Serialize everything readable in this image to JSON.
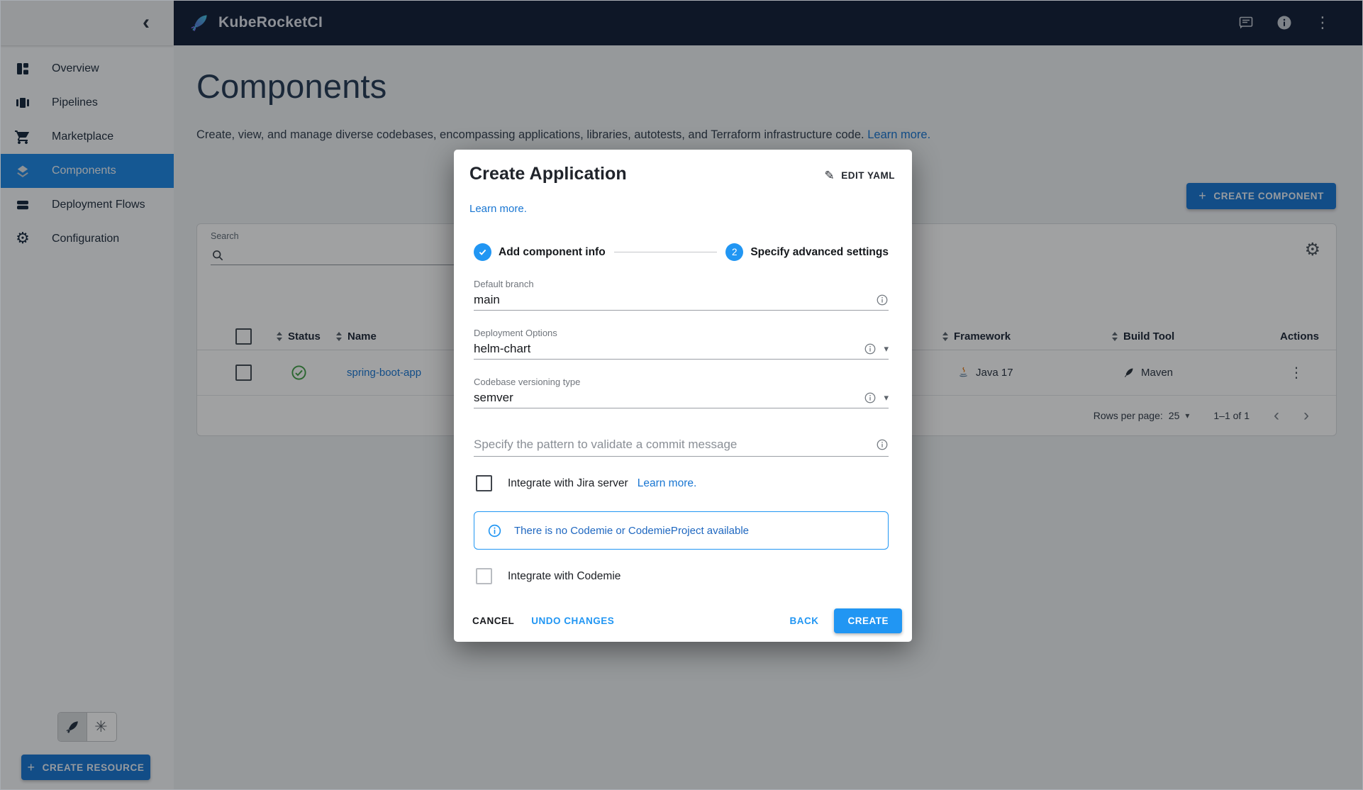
{
  "icons": {
    "collapse": "‹",
    "kebab": "⋮",
    "gear": "⚙",
    "k8s_wheel": "✳",
    "pencil": "✎",
    "plus": "+",
    "caret": "▾",
    "prev": "‹",
    "next": "›"
  },
  "topbar": {
    "app_name": "KubeRocketCI"
  },
  "sidebar": {
    "items": [
      {
        "label": "Overview"
      },
      {
        "label": "Pipelines"
      },
      {
        "label": "Marketplace"
      },
      {
        "label": "Components"
      },
      {
        "label": "Deployment Flows"
      },
      {
        "label": "Configuration"
      }
    ],
    "active_item": "Components",
    "create_resource": "CREATE RESOURCE"
  },
  "page": {
    "title": "Components",
    "description": "Create, view, and manage diverse codebases, encompassing applications, libraries, autotests, and Terraform infrastructure code.",
    "learn_more": "Learn more.",
    "create_component": "CREATE COMPONENT"
  },
  "table": {
    "search_label": "Search",
    "columns": [
      {
        "label": "Status"
      },
      {
        "label": "Name"
      },
      {
        "label": "Framework"
      },
      {
        "label": "Build Tool"
      },
      {
        "label": "Actions"
      }
    ],
    "rows": [
      {
        "status": "success",
        "name": "spring-boot-app",
        "framework": "Java 17",
        "build_tool": "Maven"
      }
    ],
    "pagination": {
      "rows_per_page_label": "Rows per page:",
      "rows_per_page": "25",
      "range": "1–1 of 1"
    }
  },
  "modal": {
    "title": "Create Application",
    "edit_yaml": "EDIT YAML",
    "learn_more": "Learn more.",
    "steps": [
      {
        "label": "Add component info",
        "state": "done"
      },
      {
        "label": "Specify advanced settings",
        "number": "2",
        "state": "active"
      }
    ],
    "fields": {
      "default_branch": {
        "label": "Default branch",
        "value": "main"
      },
      "deployment_options": {
        "label": "Deployment Options",
        "value": "helm-chart"
      },
      "versioning": {
        "label": "Codebase versioning type",
        "value": "semver"
      },
      "commit_pattern": {
        "placeholder": "Specify the pattern to validate a commit message"
      }
    },
    "jira": {
      "label": "Integrate with Jira server",
      "link": "Learn more."
    },
    "alert": {
      "text": "There is no Codemie or CodemieProject available"
    },
    "codemie": {
      "label": "Integrate with Codemie"
    },
    "actions": {
      "cancel": "CANCEL",
      "undo": "UNDO CHANGES",
      "back": "BACK",
      "create": "CREATE"
    }
  },
  "colors": {
    "primary": "#2196f3",
    "link": "#1976d2",
    "button_blue": "#1976d2",
    "sidebar_active": "#1e88e5",
    "success_green": "#43a047",
    "topbar_bg": "#131f38",
    "alert_text": "#1e67c0"
  }
}
